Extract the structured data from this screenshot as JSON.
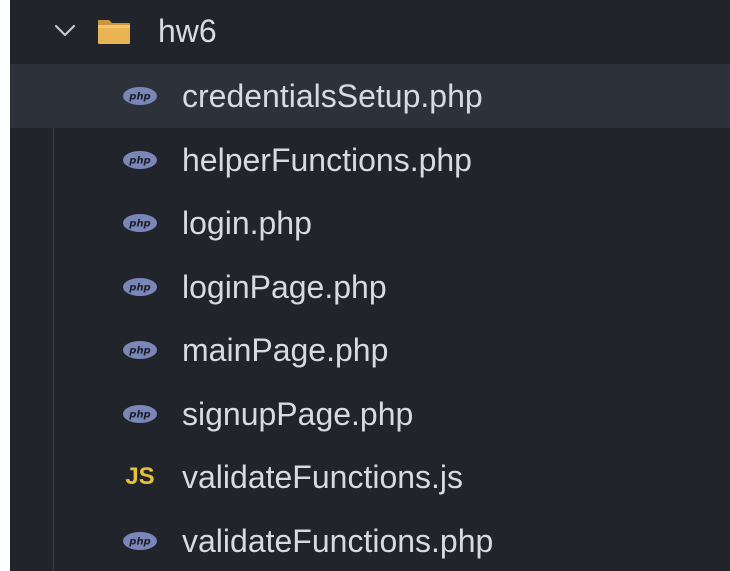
{
  "explorer": {
    "folder": {
      "name": "hw6",
      "expanded": true,
      "chevron_icon": "chevron-down-icon",
      "folder_icon": "folder-open-icon",
      "folder_color": "#e8b454"
    },
    "files": [
      {
        "name": "credentialsSetup.php",
        "icon": "php-file-icon",
        "selected": true
      },
      {
        "name": "helperFunctions.php",
        "icon": "php-file-icon",
        "selected": false
      },
      {
        "name": "login.php",
        "icon": "php-file-icon",
        "selected": false
      },
      {
        "name": "loginPage.php",
        "icon": "php-file-icon",
        "selected": false
      },
      {
        "name": "mainPage.php",
        "icon": "php-file-icon",
        "selected": false
      },
      {
        "name": "signupPage.php",
        "icon": "php-file-icon",
        "selected": false
      },
      {
        "name": "validateFunctions.js",
        "icon": "js-file-icon",
        "icon_text": "JS",
        "selected": false
      },
      {
        "name": "validateFunctions.php",
        "icon": "php-file-icon",
        "selected": false
      }
    ],
    "colors": {
      "background": "#21252b",
      "selected_row": "#2c313a",
      "text": "#d7dae0",
      "php_badge": "#7a86b8",
      "js_badge": "#e5c23c"
    },
    "php_badge_text": "php"
  }
}
